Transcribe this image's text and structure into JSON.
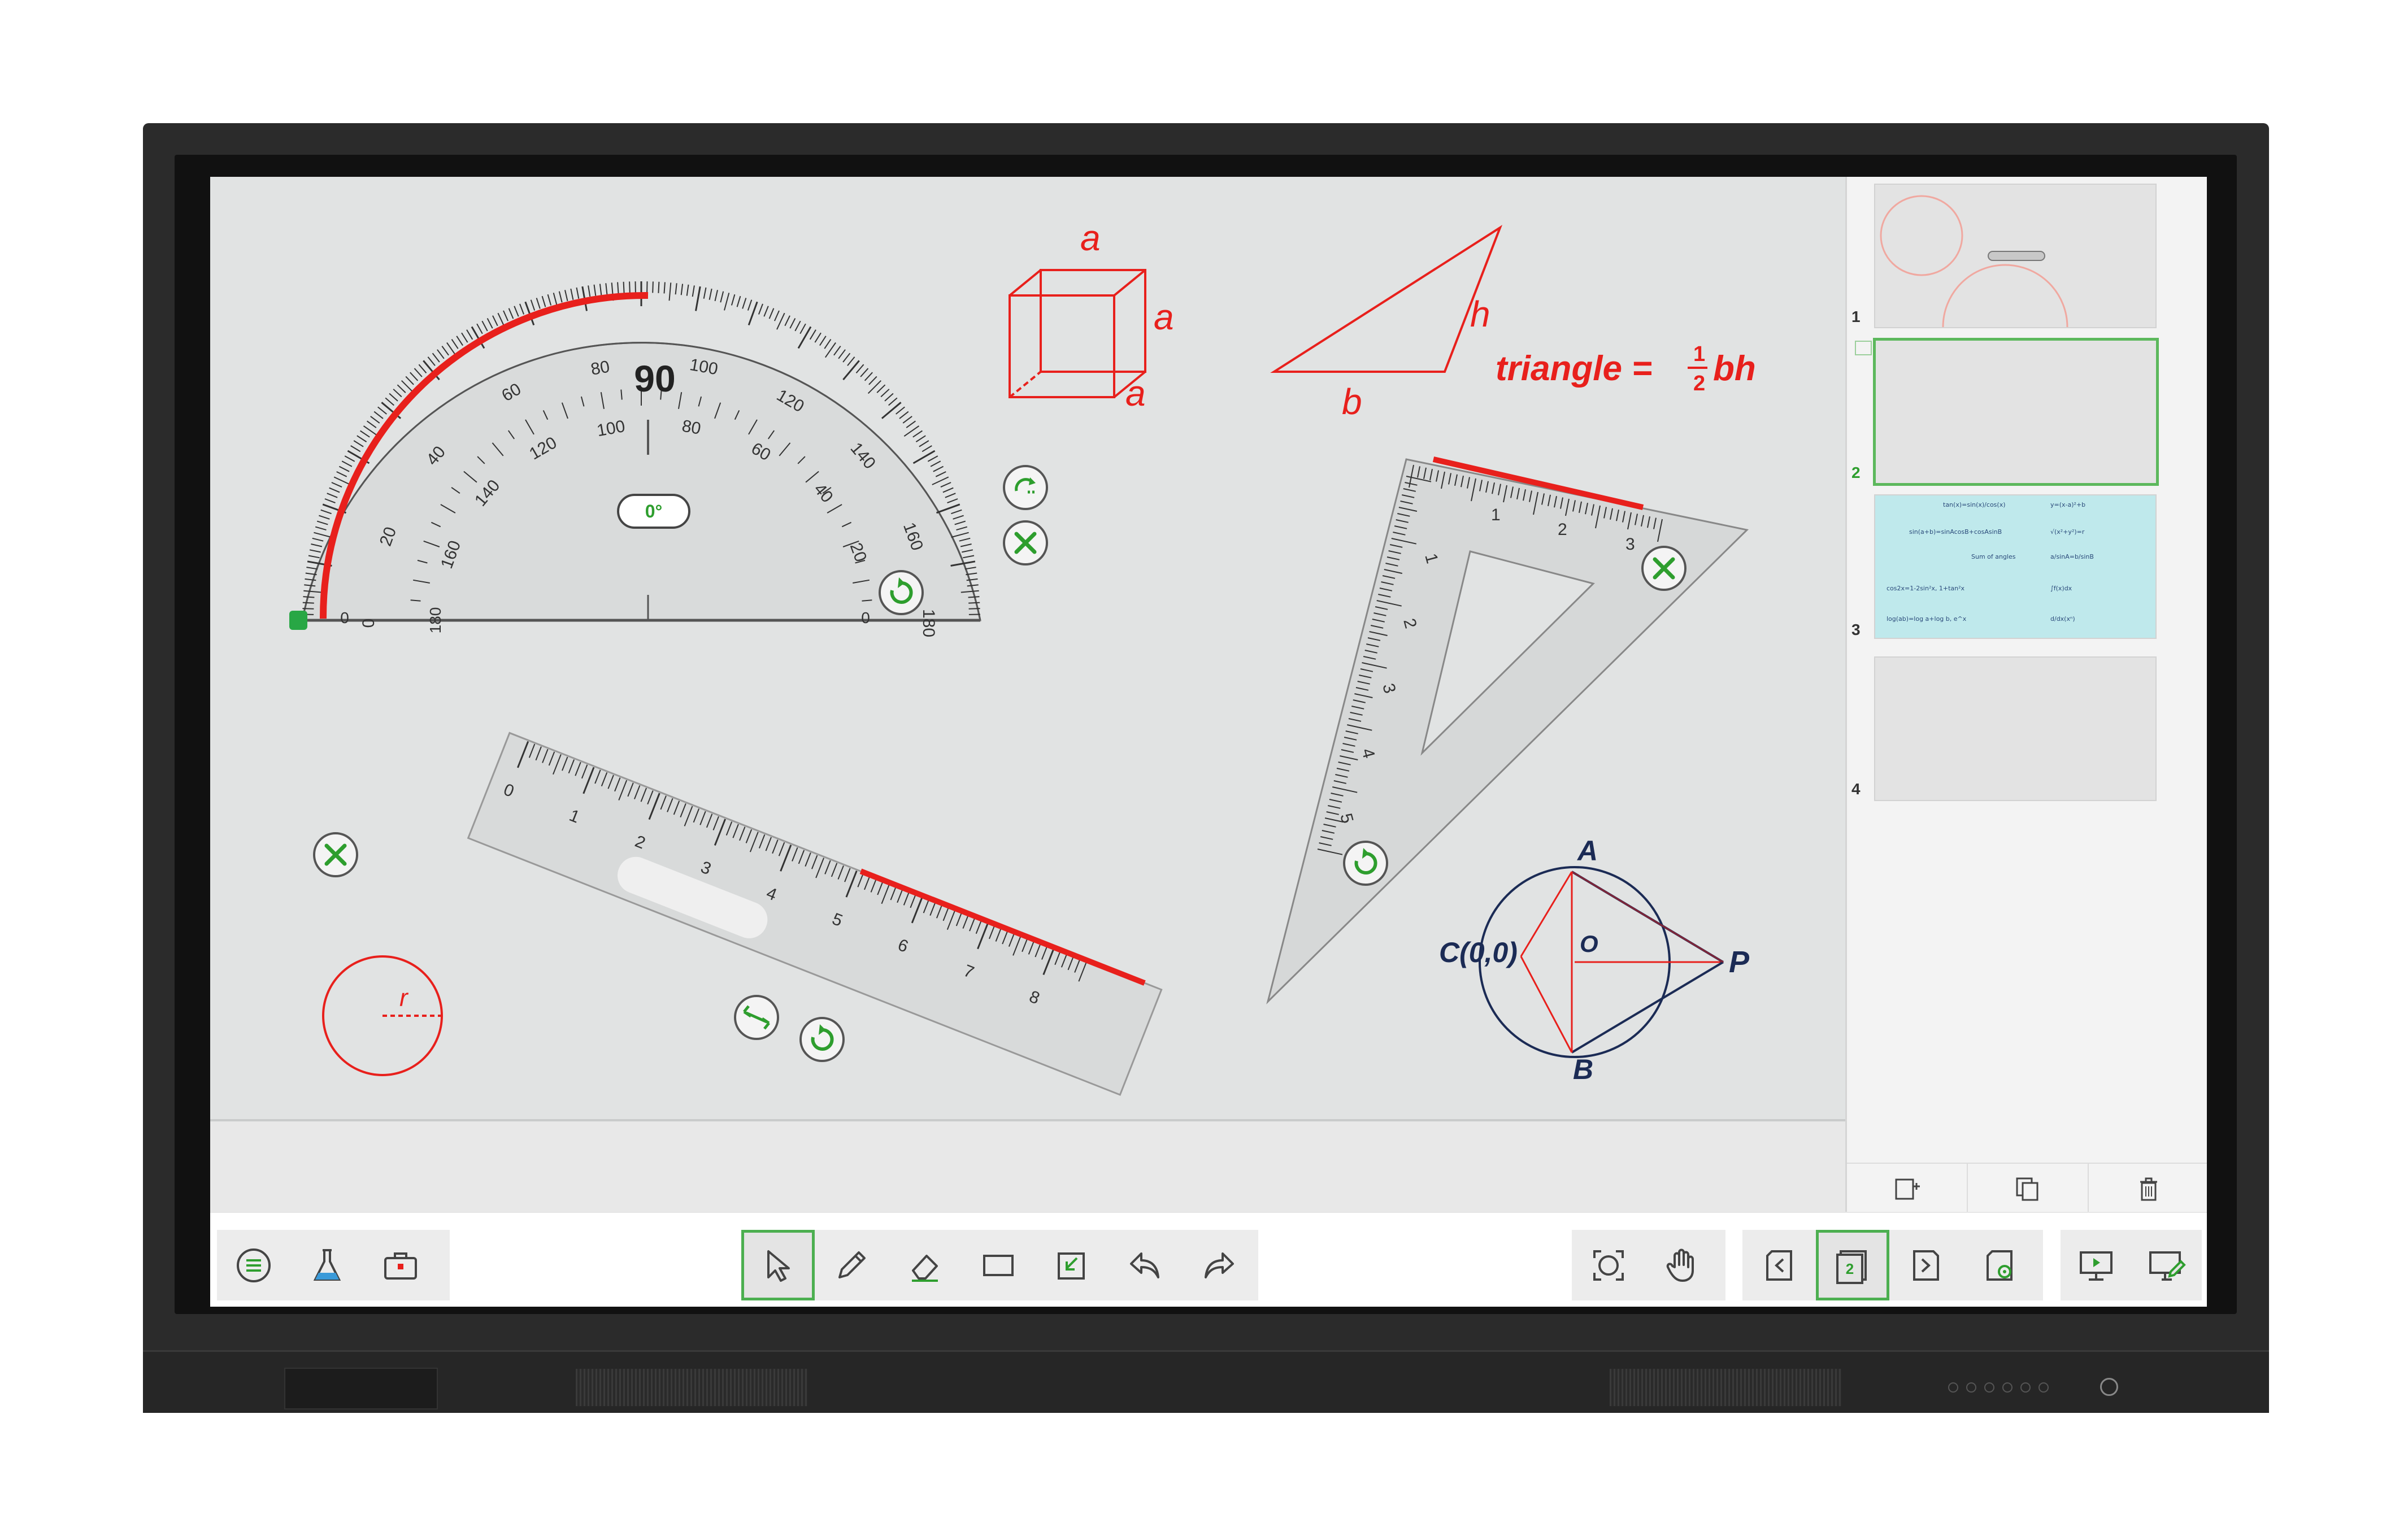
{
  "protractor": {
    "top_labels": [
      "0",
      "20",
      "40",
      "60",
      "80",
      "90",
      "100",
      "120",
      "140",
      "160",
      "180"
    ],
    "inner_labels": [
      "180",
      "160",
      "140",
      "120",
      "100",
      "80",
      "60",
      "40",
      "20",
      "0"
    ],
    "angle_readout": "0°"
  },
  "cube": {
    "label_top": "a",
    "label_right": "a",
    "label_bottom": "a"
  },
  "triangle": {
    "label_base": "b",
    "label_height": "h",
    "formula": "triangle = ",
    "formula_num": "1",
    "formula_den": "2",
    "formula_tail": "bh"
  },
  "set_square": {
    "labels": [
      "1",
      "2",
      "3",
      "1",
      "2",
      "3",
      "4",
      "5"
    ]
  },
  "ruler": {
    "labels": [
      "0",
      "1",
      "2",
      "3",
      "4",
      "5",
      "6",
      "7",
      "8"
    ]
  },
  "small_circle": {
    "label": "r"
  },
  "tangent_figure": {
    "label_a": "A",
    "label_b": "B",
    "label_c": "C(0,0)",
    "label_o": "O",
    "label_p": "P"
  },
  "pages": [
    {
      "number": "1",
      "active": false
    },
    {
      "number": "2",
      "active": true
    },
    {
      "number": "3",
      "active": false
    },
    {
      "number": "4",
      "active": false
    }
  ],
  "page3_text": [
    [
      "tan(x)=sin(x)/cos(x)",
      "y=(x-a)²+b"
    ],
    [
      "sin(a+b)=sinAcosB+cosAsinB",
      "√(x²+y²)=r"
    ],
    [
      "Sum of angles",
      "a/sinA=b/sinB"
    ],
    [
      "cos2x=1-2sin²x, 1+tan²x",
      "∫f(x)dx"
    ],
    [
      "log(ab)=log a+log b, e^x",
      "d/dx(xⁿ)"
    ]
  ],
  "colors": {
    "accent": "#4caf50",
    "ink_red": "#e8201c",
    "ink_navy": "#1b2b55"
  },
  "toolbar": {
    "left": [
      "menu-icon",
      "lab-flask-icon",
      "toolbox-icon"
    ],
    "center": [
      "select-arrow-icon",
      "pen-icon",
      "eraser-icon",
      "rectangle-icon",
      "insert-icon",
      "undo-icon",
      "redo-icon"
    ],
    "right": [
      "zoom-fit-icon",
      "hand-pan-icon",
      "previous-page-icon",
      "page-number-icon",
      "next-page-icon",
      "page-settings-icon",
      "present-icon",
      "annotate-screen-icon"
    ],
    "current_page": "2"
  }
}
